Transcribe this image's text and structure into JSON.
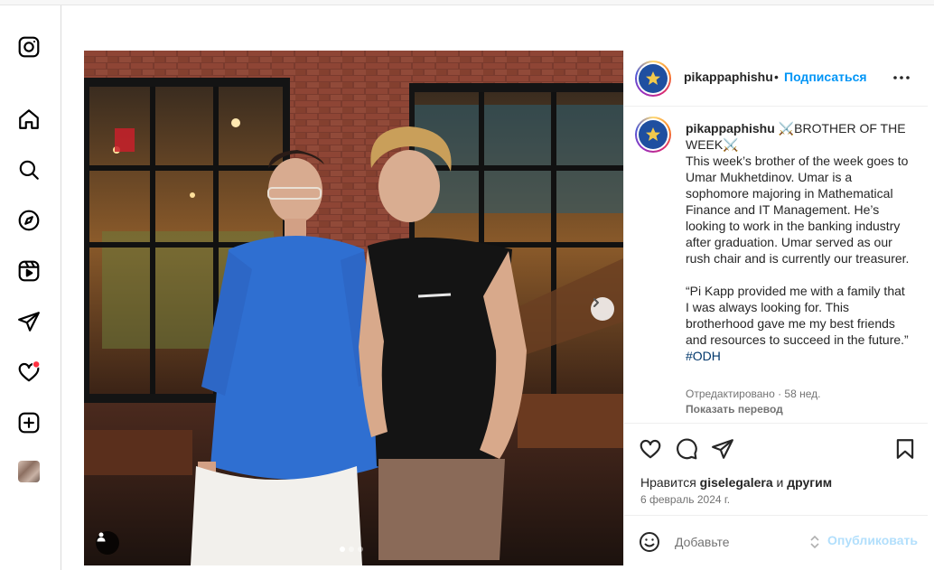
{
  "post": {
    "username": "pikappaphishu",
    "separator": "•",
    "follow_label": "Подписаться",
    "caption_title": " ⚔️BROTHER OF THE WEEK⚔️",
    "caption_body": "This week’s brother of the week goes to Umar Mukhetdinov. Umar is a sophomore majoring in Mathematical Finance and IT Management. He’s looking to work in the banking industry after graduation. Umar served as our rush chair and is currently our treasurer.",
    "caption_quote": "“Pi Kapp provided me with a family that I was always looking for. This brotherhood gave me my best friends and resources to succeed in the future.” ",
    "hashtag": "#ODH",
    "edited_meta": "Отредактировано · 58 нед.",
    "translate_label": "Показать перевод",
    "likes_prefix": "Нравится ",
    "likes_user": "giselegalera",
    "likes_middle": " и ",
    "likes_suffix": "другим",
    "date": "6 февраль 2024 г.",
    "comment_placeholder": "Добавьте",
    "publish_label": "Опубликовать",
    "carousel_total": 3,
    "carousel_current": 1
  },
  "sidebar": {
    "icons": [
      "instagram-logo-icon",
      "home-icon",
      "search-icon",
      "explore-icon",
      "reels-icon",
      "messages-icon",
      "notifications-icon",
      "create-icon",
      "profile-avatar"
    ]
  },
  "colors": {
    "accent": "#0095f6",
    "link": "#00376b",
    "muted": "#737373",
    "publish_disabled": "#b2dffc",
    "notification_dot": "#ff3040"
  }
}
